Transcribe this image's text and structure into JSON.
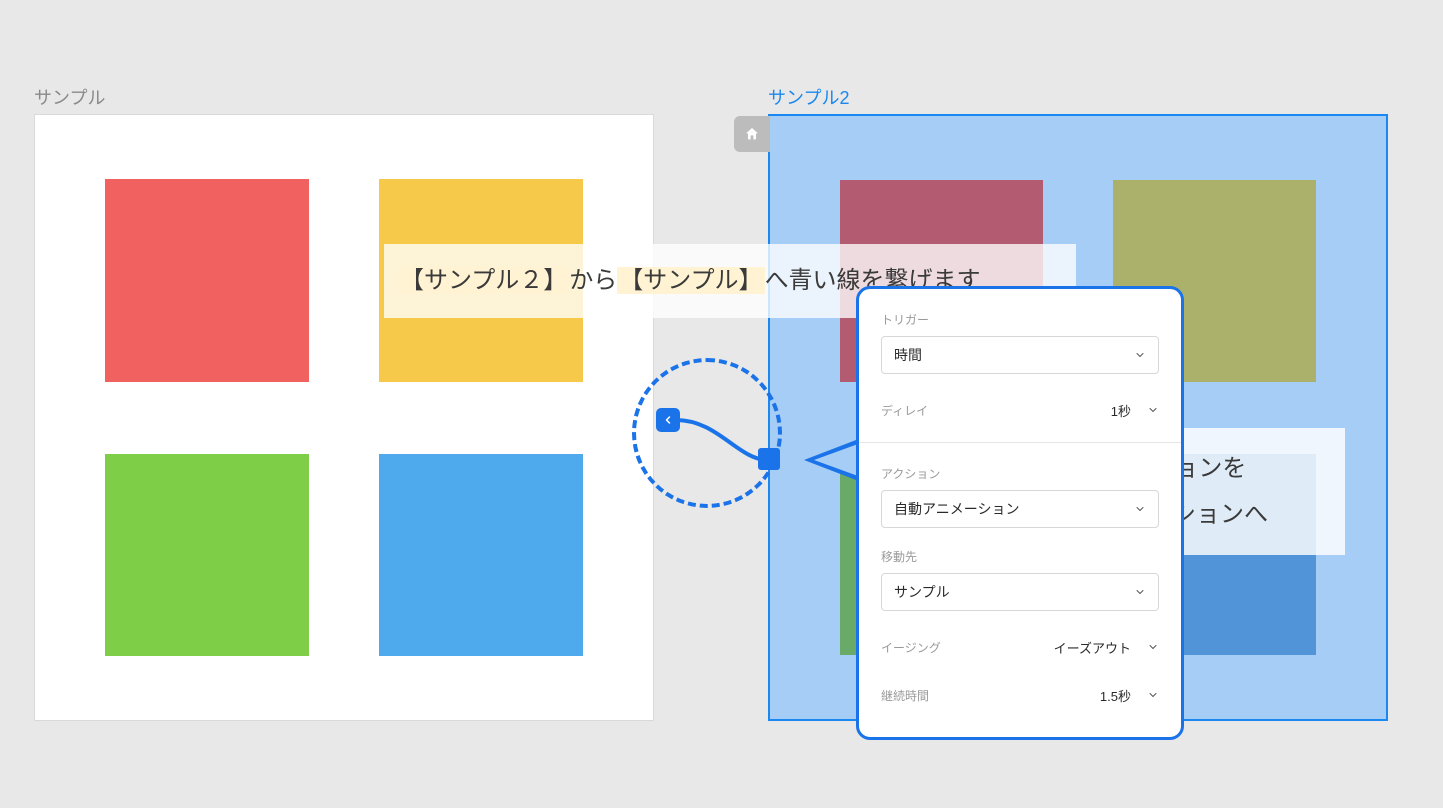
{
  "artboard1": {
    "label": "サンプル"
  },
  "artboard2": {
    "label": "サンプル2"
  },
  "callout_top": {
    "hl1": "【サンプル２】",
    "mid": "から",
    "hl2": "【サンプル】",
    "rest": "へ青い線を繋げます"
  },
  "callout_right": {
    "line1": "アクションを",
    "line2": "自動アニメーションへ"
  },
  "panel": {
    "trigger_label": "トリガー",
    "trigger_value": "時間",
    "delay_label": "ディレイ",
    "delay_value": "1秒",
    "action_label": "アクション",
    "action_value": "自動アニメーション",
    "destination_label": "移動先",
    "destination_value": "サンプル",
    "easing_label": "イージング",
    "easing_value": "イーズアウト",
    "duration_label": "継続時間",
    "duration_value": "1.5秒"
  }
}
